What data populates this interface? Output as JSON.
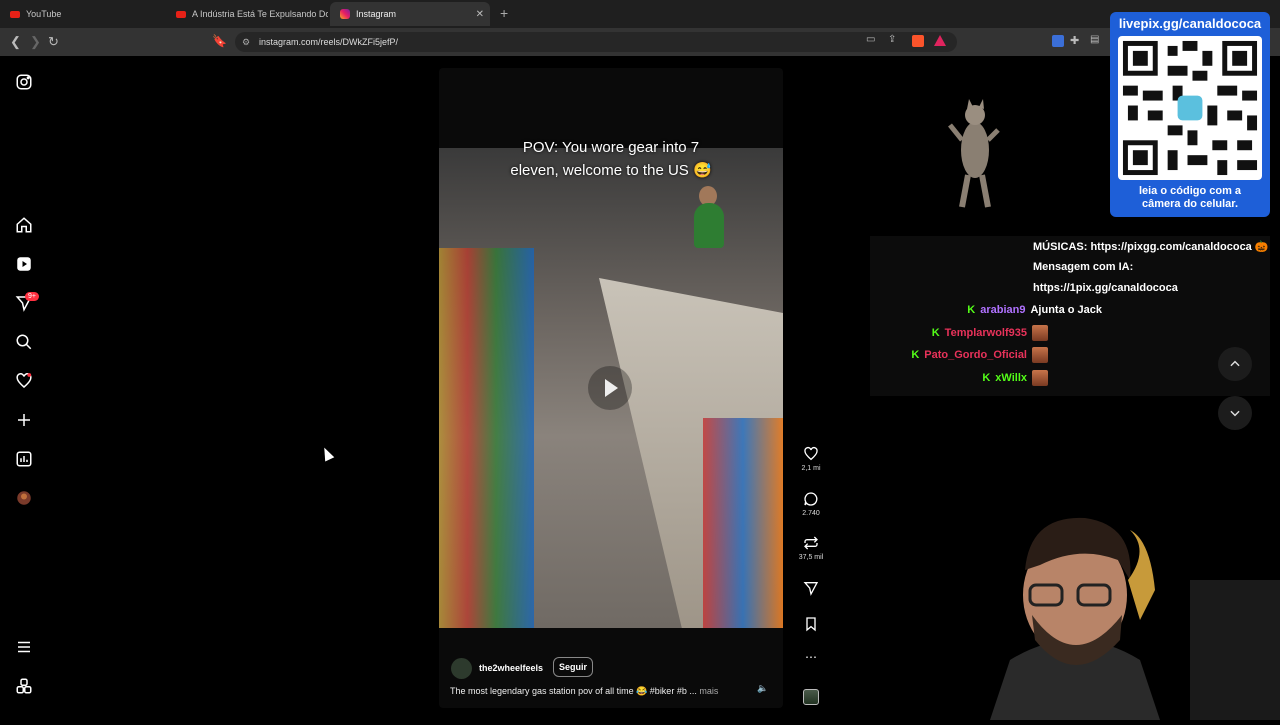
{
  "browser": {
    "tabs": [
      {
        "title": "YouTube"
      },
      {
        "title": "A Indústria Está Te Expulsando Do G..."
      },
      {
        "title": "Instagram"
      }
    ],
    "url": "instagram.com/reels/DWkZFi5jefP/"
  },
  "sidebar": {
    "notification_badge": "9+",
    "icons": [
      "instagram-icon",
      "home-icon",
      "reels-icon",
      "messages-icon",
      "search-icon",
      "heart-icon",
      "create-icon",
      "dashboard-icon",
      "profile-avatar",
      "menu-icon",
      "more-icon"
    ]
  },
  "reel": {
    "caption_line1": "POV: You wore gear into 7",
    "caption_line2": "eleven, welcome to the US 😅",
    "username": "the2wheelfeels",
    "follow_label": "Seguir",
    "description": "The most legendary gas station pov of all time 😂 #biker #b ...",
    "more_label": "mais",
    "likes": "2,1 mi",
    "comments": "2.740",
    "reposts": "37,5 mil"
  },
  "overlay": {
    "qr_title": "livepix.gg/canaldococa",
    "qr_subtitle_line1": "leia o código com a",
    "qr_subtitle_line2": "câmera do celular.",
    "chat_info_1": "MÚSICAS: https://pixgg.com/canaldococa 🎃",
    "chat_info_2": "Mensagem com IA:",
    "chat_info_3": "https://1pix.gg/canaldococa",
    "messages": [
      {
        "user": "arabian9",
        "text": "Ajunta o Jack",
        "color": "#b072ff"
      },
      {
        "user": "Templarwolf935",
        "text": "",
        "color": "#e8325a"
      },
      {
        "user": "Pato_Gordo_Oficial",
        "text": "",
        "color": "#e8325a"
      },
      {
        "user": "xWillx",
        "text": "",
        "color": "#53fc18"
      }
    ]
  }
}
